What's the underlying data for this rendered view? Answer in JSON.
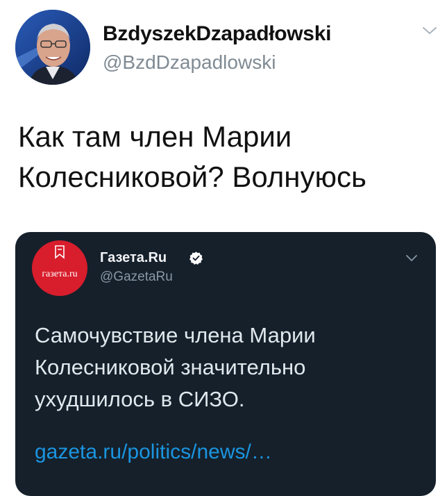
{
  "tweet": {
    "author": {
      "display_name": "BzdyszekDzapadłowski",
      "handle": "@BzdDzapadlowski",
      "avatar_icon": "user-avatar-photo"
    },
    "menu_icon": "chevron-down-icon",
    "text_lines": [
      "Как там член Марии",
      "Колесниковой? Волнуюсь"
    ]
  },
  "quoted_tweet": {
    "author": {
      "display_name": "Газета.Ru",
      "handle": "@GazetaRu",
      "verified": true,
      "avatar_logo_text": "газета.ru",
      "avatar_color": "#d81d2c"
    },
    "menu_icon": "chevron-down-icon",
    "text_lines": [
      "Самочувствие члена Марии",
      "Колесниковой значительно",
      "ухудшилось в СИЗО."
    ],
    "link_text": "gazeta.ru/politics/news/…",
    "colors": {
      "background": "#15202b",
      "text": "#e1e8ed",
      "secondary": "#8899a6",
      "link": "#1b95e0"
    }
  }
}
